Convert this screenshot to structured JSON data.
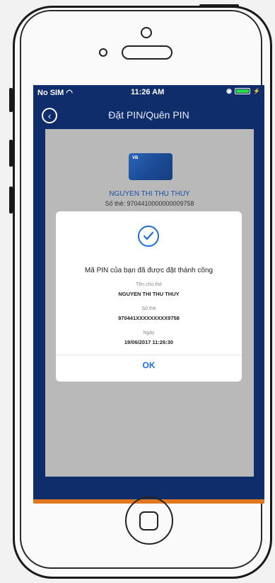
{
  "status_bar": {
    "carrier": "No SIM",
    "time": "11:26 AM"
  },
  "header": {
    "title": "Đặt PIN/Quên PIN"
  },
  "card": {
    "brand": "VB",
    "holder": "NGUYEN THI THU THUY",
    "number_partial": "Số thẻ: 9704410000000009758"
  },
  "dialog": {
    "message": "Mã PIN của bạn đã được đặt thành công",
    "holder_label": "Tên chủ thẻ",
    "holder_value": "NGUYEN THI THU THUY",
    "card_label": "Số thẻ",
    "card_value": "970441XXXXXXXXX9758",
    "date_label": "Ngày",
    "date_value": "19/06/2017 11:26:30",
    "ok_label": "OK"
  },
  "colors": {
    "screen_bg": "#0f2c6b",
    "accent": "#1a6fd6",
    "battery": "#2bd84a"
  }
}
